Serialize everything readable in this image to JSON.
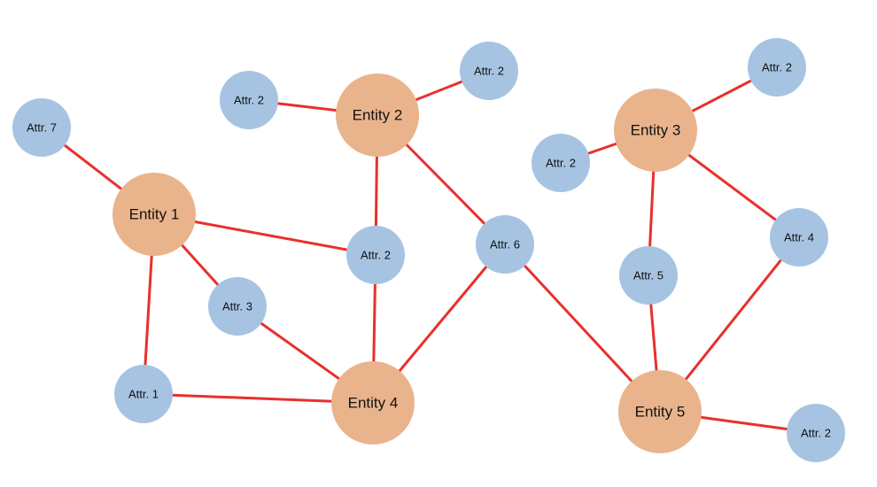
{
  "diagram": {
    "type": "entity-attribute graph",
    "colors": {
      "entity_fill": "#e9b48c",
      "attribute_fill": "#a6c4e2",
      "edge": "#e8302c",
      "label": "#111111",
      "background": "#ffffff"
    },
    "nodes": [
      {
        "id": "e1",
        "kind": "entity",
        "label": "Entity 1"
      },
      {
        "id": "e2",
        "kind": "entity",
        "label": "Entity 2"
      },
      {
        "id": "e3",
        "kind": "entity",
        "label": "Entity 3"
      },
      {
        "id": "e4",
        "kind": "entity",
        "label": "Entity 4"
      },
      {
        "id": "e5",
        "kind": "entity",
        "label": "Entity 5"
      },
      {
        "id": "a7",
        "kind": "attribute",
        "label": "Attr. 7"
      },
      {
        "id": "a2_tl",
        "kind": "attribute",
        "label": "Attr. 2"
      },
      {
        "id": "a2_tm",
        "kind": "attribute",
        "label": "Attr. 2"
      },
      {
        "id": "a2_mid",
        "kind": "attribute",
        "label": "Attr. 2"
      },
      {
        "id": "a3",
        "kind": "attribute",
        "label": "Attr. 3"
      },
      {
        "id": "a1",
        "kind": "attribute",
        "label": "Attr. 1"
      },
      {
        "id": "a6",
        "kind": "attribute",
        "label": "Attr. 6"
      },
      {
        "id": "a2_e3l",
        "kind": "attribute",
        "label": "Attr. 2"
      },
      {
        "id": "a2_tr",
        "kind": "attribute",
        "label": "Attr. 2"
      },
      {
        "id": "a5",
        "kind": "attribute",
        "label": "Attr. 5"
      },
      {
        "id": "a4",
        "kind": "attribute",
        "label": "Attr. 4"
      },
      {
        "id": "a2_br",
        "kind": "attribute",
        "label": "Attr. 2"
      }
    ],
    "edges": [
      [
        "a7",
        "e1"
      ],
      [
        "e1",
        "a2_mid"
      ],
      [
        "e1",
        "a3"
      ],
      [
        "e1",
        "a1"
      ],
      [
        "a2_tl",
        "e2"
      ],
      [
        "e2",
        "a2_tm"
      ],
      [
        "e2",
        "a2_mid"
      ],
      [
        "e2",
        "a6"
      ],
      [
        "a2_mid",
        "e4"
      ],
      [
        "a3",
        "e4"
      ],
      [
        "a1",
        "e4"
      ],
      [
        "a6",
        "e4"
      ],
      [
        "a6",
        "e5"
      ],
      [
        "a2_e3l",
        "e3"
      ],
      [
        "e3",
        "a2_tr"
      ],
      [
        "e3",
        "a5"
      ],
      [
        "e3",
        "a4"
      ],
      [
        "a5",
        "e5"
      ],
      [
        "a4",
        "e5"
      ],
      [
        "e5",
        "a2_br"
      ]
    ]
  }
}
